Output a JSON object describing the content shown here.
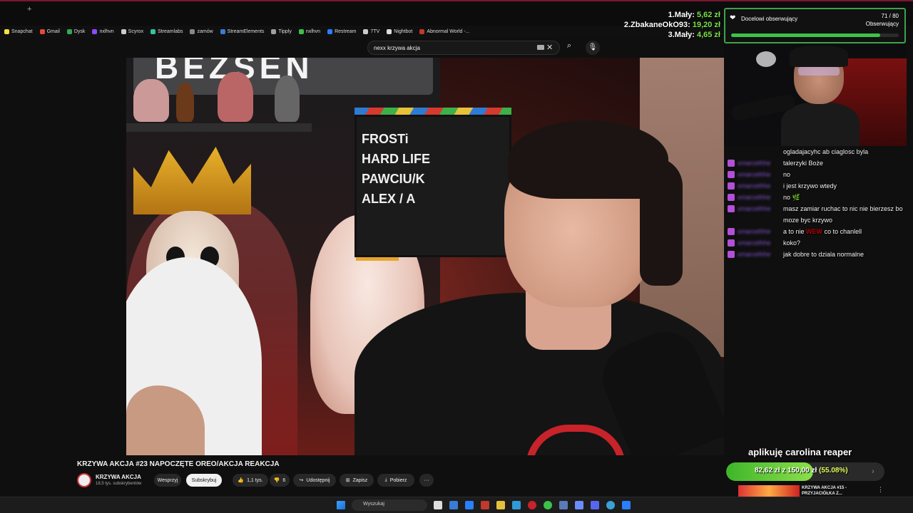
{
  "browser": {
    "new_tab_symbol": "+",
    "bookmarks": [
      {
        "label": "Snapchat",
        "color": "#f7e03a"
      },
      {
        "label": "Gmail",
        "color": "#e04a3a"
      },
      {
        "label": "Dysk",
        "color": "#34a853"
      },
      {
        "label": "nxlhvn",
        "color": "#9146ff"
      },
      {
        "label": "Scyrox",
        "color": "#cccccc"
      },
      {
        "label": "Streamlabs",
        "color": "#31c3a2"
      },
      {
        "label": "zamów",
        "color": "#888888"
      },
      {
        "label": "StreamElements",
        "color": "#3a7bd5"
      },
      {
        "label": "Tipply",
        "color": "#9aa0a6"
      },
      {
        "label": "nxlhvn",
        "color": "#3cc24a"
      },
      {
        "label": "Restream",
        "color": "#2a7fff"
      },
      {
        "label": "7TV",
        "color": "#cccccc"
      },
      {
        "label": "Nightbot",
        "color": "#dddddd"
      },
      {
        "label": "Abnormal World -...",
        "color": "#c0392b"
      }
    ]
  },
  "top_donors": [
    {
      "rank_name": "1.Mały:",
      "amount": "5,62 zł"
    },
    {
      "rank_name": "2.ZbakaneOkO93:",
      "amount": "19,20 zł"
    },
    {
      "rank_name": "3.Mały:",
      "amount": "4,65 zł"
    }
  ],
  "follower_goal": {
    "title": "Docelowi obserwujący",
    "count": "71 / 80",
    "label": "Obserwujący",
    "progress": 0.8875
  },
  "youtube": {
    "search_value": "nexx krzywa akcja",
    "video_title": "KRZYWA AKCJA #23 NAPOCZĘTE OREO/AKCJA REAKCJA",
    "channel": "KRZYWA AKCJA",
    "subscribers": "18,5 tys. subskrybentów",
    "buttons": {
      "support": "Wesprzyj",
      "subscribe": "Subskrybuj",
      "likes": "1,1 tys.",
      "dislikes": "6",
      "share": "Udostępnij",
      "save": "Zapisz",
      "download": "Pobierz",
      "more": "···"
    },
    "sign_text": "BEZSEN",
    "clapper_text": "FROSTi\nHARD LIFE\nPAWCIU/K\nALEX / A",
    "next_video": {
      "title_line1": "KRZYWA AKCJA #15 -",
      "title_line2": "PRZYJACIÓŁKA Z..."
    }
  },
  "chat": {
    "top_line": "ogladajacyhc ab ciaglosc byla",
    "messages": [
      {
        "user": "xmarcelhhe",
        "text": "talerzyki Boże"
      },
      {
        "user": "xmarcelhhe",
        "text": "no"
      },
      {
        "user": "xmarcelhhe",
        "text": "i jest krzywo wtedy"
      },
      {
        "user": "xmarcelhhe",
        "text": "no 🌿"
      },
      {
        "user": "xmarcelhhe",
        "text": "masz zamiar ruchac to nic nie bierzesz bo moze byc krzywo"
      },
      {
        "user": "xmarcelhhe",
        "text": "a to nie",
        "emote": "WEW",
        "text_after": "co to chanlell"
      },
      {
        "user": "xmarcelhhe",
        "text": "koko?"
      },
      {
        "user": "xmarcelhhe",
        "text": "jak dobre to dziala normalne"
      }
    ]
  },
  "donation_goal": {
    "title": "aplikuję carolina reaper",
    "current": "82,62 zł",
    "separator": "z",
    "target": "150,00 zł",
    "percent": "(55.08%)",
    "progress": 0.5508
  },
  "taskbar": {
    "search_placeholder": "Wyszukaj",
    "apps": [
      "file-explorer",
      "terminal",
      "vscode",
      "browser-red",
      "files",
      "app-blue",
      "opera",
      "chrome",
      "steam",
      "vpn",
      "discord",
      "app-round",
      "edge"
    ]
  },
  "colors": {
    "accent_green": "#3cc24a",
    "donor_amount": "#7be04a",
    "chat_user": "#8b5bd6",
    "yt_red": "#c8232a"
  }
}
